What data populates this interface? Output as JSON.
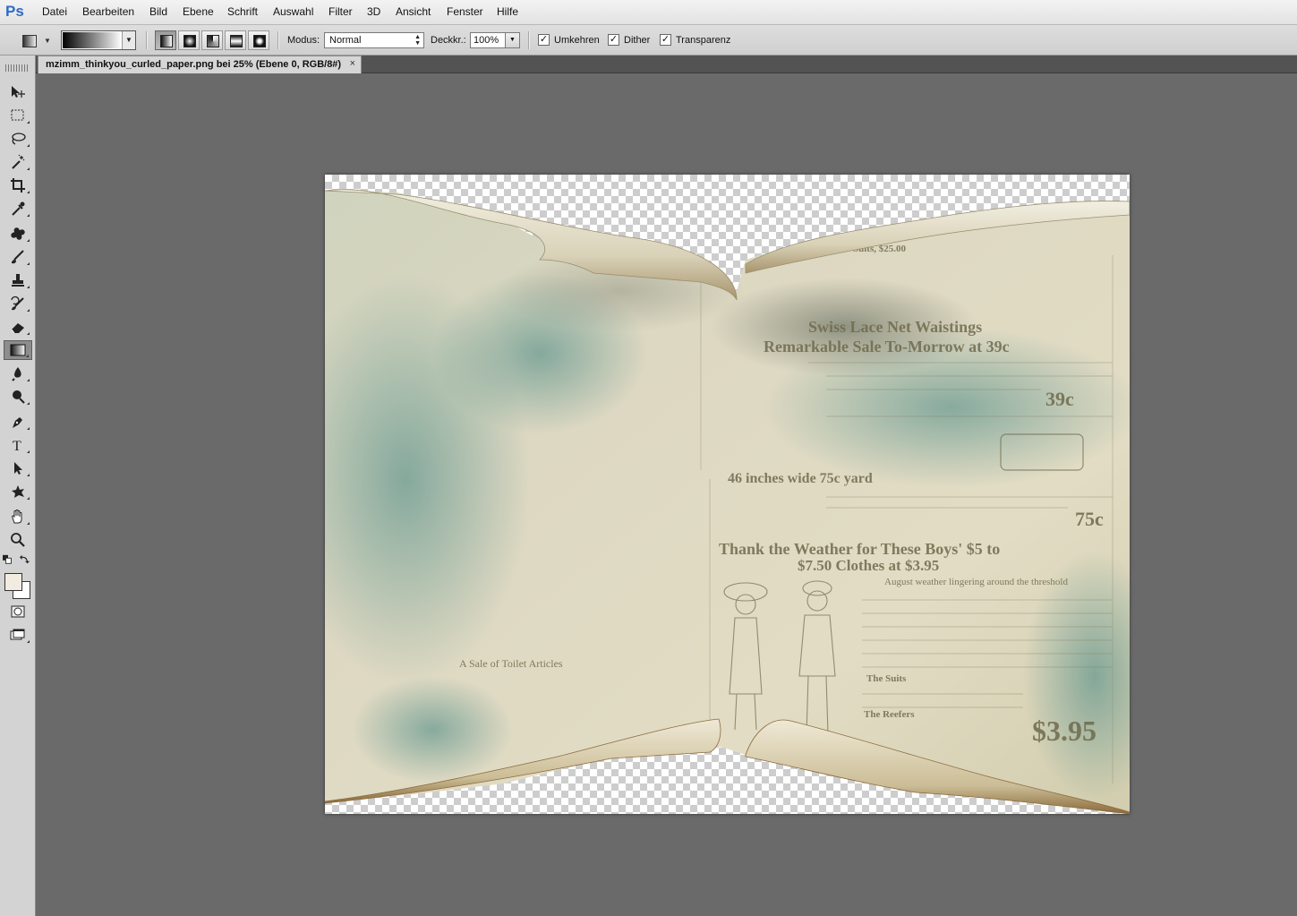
{
  "app": {
    "logo": "Ps"
  },
  "menu": [
    "Datei",
    "Bearbeiten",
    "Bild",
    "Ebene",
    "Schrift",
    "Auswahl",
    "Filter",
    "3D",
    "Ansicht",
    "Fenster",
    "Hilfe"
  ],
  "options": {
    "mode_label": "Modus:",
    "mode_value": "Normal",
    "opacity_label": "Deckkr.:",
    "opacity_value": "100%",
    "reverse_label": "Umkehren",
    "reverse_checked": true,
    "dither_label": "Dither",
    "dither_checked": true,
    "transparency_label": "Transparenz",
    "transparency_checked": true,
    "gradient_types": [
      "linear",
      "radial",
      "angle",
      "reflected",
      "diamond"
    ],
    "active_gradient_type": "linear"
  },
  "document": {
    "tab_title": "mzimm_thinkyou_curled_paper.png bei 25% (Ebene 0, RGB/8#)",
    "close_glyph": "×"
  },
  "colors": {
    "foreground": "#f1ebe0",
    "background": "#ffffff",
    "paper_base": "#ddd6bd",
    "paper_stain": "#4e8d87",
    "ink": "#6f6a4c",
    "logo": "#2e6bc8"
  },
  "tools": [
    {
      "name": "move-tool-icon"
    },
    {
      "name": "marquee-tool-icon"
    },
    {
      "name": "lasso-tool-icon"
    },
    {
      "name": "magic-wand-tool-icon"
    },
    {
      "name": "crop-tool-icon"
    },
    {
      "name": "eyedropper-tool-icon"
    },
    {
      "name": "healing-brush-tool-icon"
    },
    {
      "name": "brush-tool-icon"
    },
    {
      "name": "clone-stamp-tool-icon"
    },
    {
      "name": "history-brush-tool-icon"
    },
    {
      "name": "eraser-tool-icon"
    },
    {
      "name": "gradient-tool-icon"
    },
    {
      "name": "blur-tool-icon"
    },
    {
      "name": "dodge-tool-icon"
    },
    {
      "name": "pen-tool-icon"
    },
    {
      "name": "type-tool-icon"
    },
    {
      "name": "path-selection-tool-icon"
    },
    {
      "name": "custom-shape-tool-icon"
    },
    {
      "name": "hand-tool-icon"
    },
    {
      "name": "zoom-tool-icon"
    }
  ],
  "active_tool": "gradient-tool-icon",
  "artwork": {
    "lines": [
      "Suits, $25.00",
      "Swiss Lace Net Waistings",
      "Remarkable Sale To-Morrow at 39c",
      "39c",
      "46 inches wide 75c yard",
      "75c",
      "Thank the Weather for These Boys' $5 to",
      "$7.50 Clothes at $3.95",
      "August weather lingering around the threshold",
      "A Sale of Toilet Articles",
      "The Suits",
      "The Reefers",
      "$3.95"
    ]
  }
}
